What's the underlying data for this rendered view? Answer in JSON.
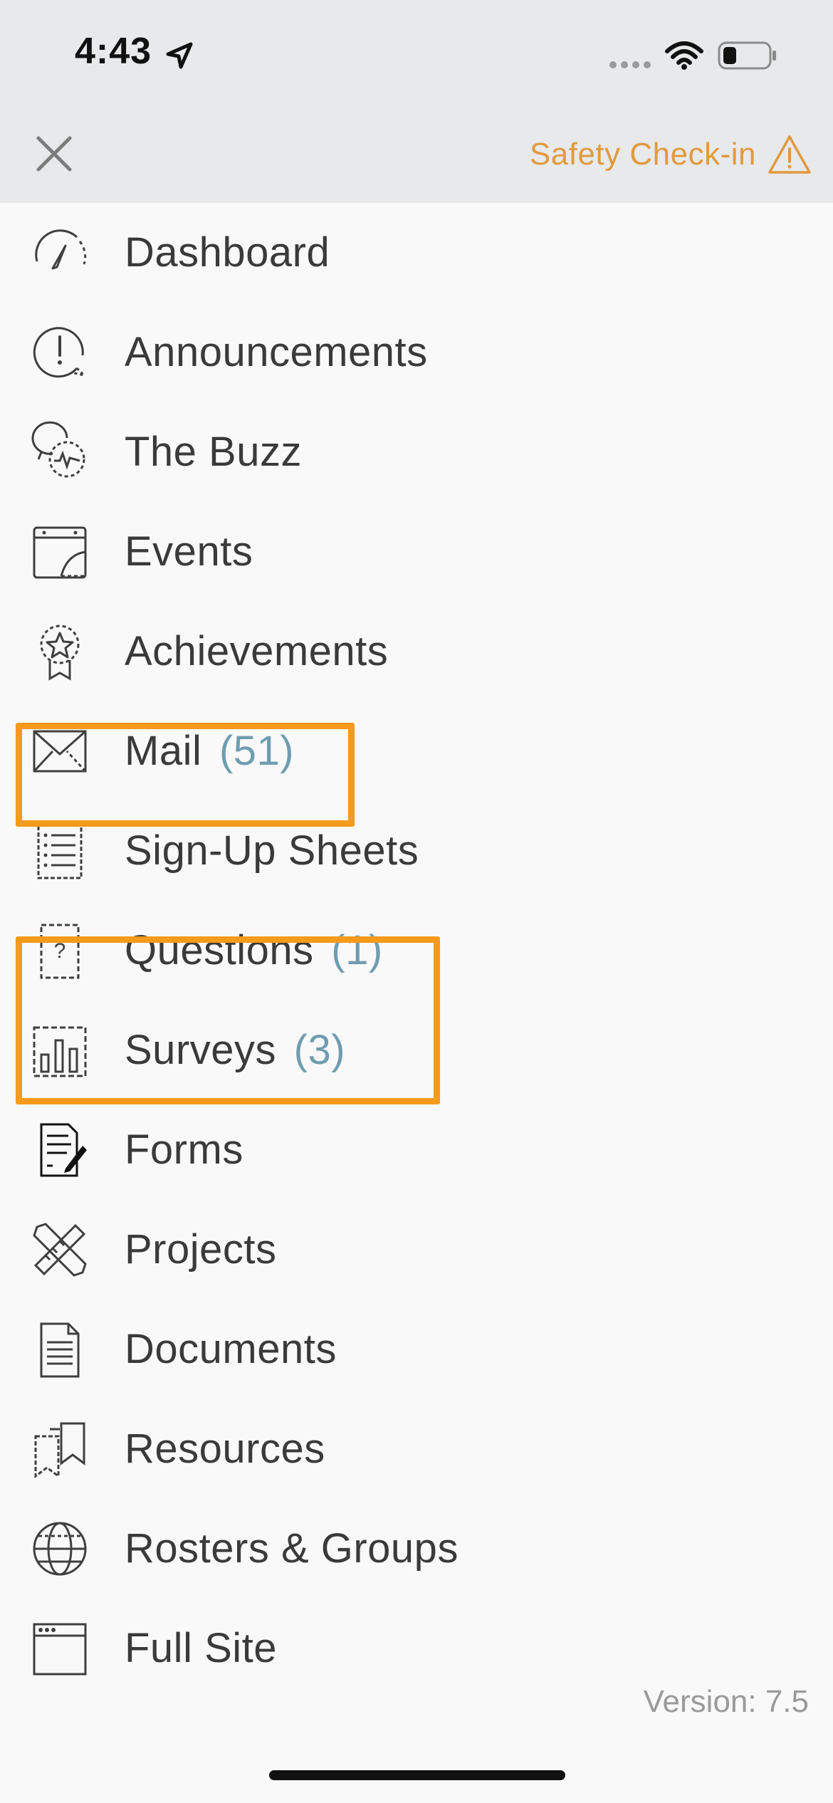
{
  "status_bar": {
    "time": "4:43"
  },
  "header": {
    "safety_label": "Safety Check-in"
  },
  "menu": {
    "items": [
      {
        "label": "Dashboard",
        "count": "",
        "icon": "dashboard-gauge-icon"
      },
      {
        "label": "Announcements",
        "count": "",
        "icon": "announcement-bubble-icon"
      },
      {
        "label": "The Buzz",
        "count": "",
        "icon": "buzz-chat-icon"
      },
      {
        "label": "Events",
        "count": "",
        "icon": "calendar-icon"
      },
      {
        "label": "Achievements",
        "count": "",
        "icon": "award-ribbon-icon"
      },
      {
        "label": "Mail",
        "count": "(51)",
        "icon": "envelope-icon"
      },
      {
        "label": "Sign-Up Sheets",
        "count": "",
        "icon": "checklist-icon"
      },
      {
        "label": "Questions",
        "count": "(1)",
        "icon": "question-doc-icon"
      },
      {
        "label": "Surveys",
        "count": "(3)",
        "icon": "bar-chart-icon"
      },
      {
        "label": "Forms",
        "count": "",
        "icon": "form-pen-icon"
      },
      {
        "label": "Projects",
        "count": "",
        "icon": "ruler-pencil-icon"
      },
      {
        "label": "Documents",
        "count": "",
        "icon": "document-icon"
      },
      {
        "label": "Resources",
        "count": "",
        "icon": "bookmarks-icon"
      },
      {
        "label": "Rosters & Groups",
        "count": "",
        "icon": "globe-icon"
      },
      {
        "label": "Full Site",
        "count": "",
        "icon": "browser-window-icon"
      }
    ]
  },
  "footer": {
    "version": "Version: 7.5"
  },
  "colors": {
    "accent_orange": "#e19a3e",
    "highlight_orange": "#f59a1b",
    "count_blue": "#6f9db0",
    "header_bg": "#e8e9eb"
  }
}
